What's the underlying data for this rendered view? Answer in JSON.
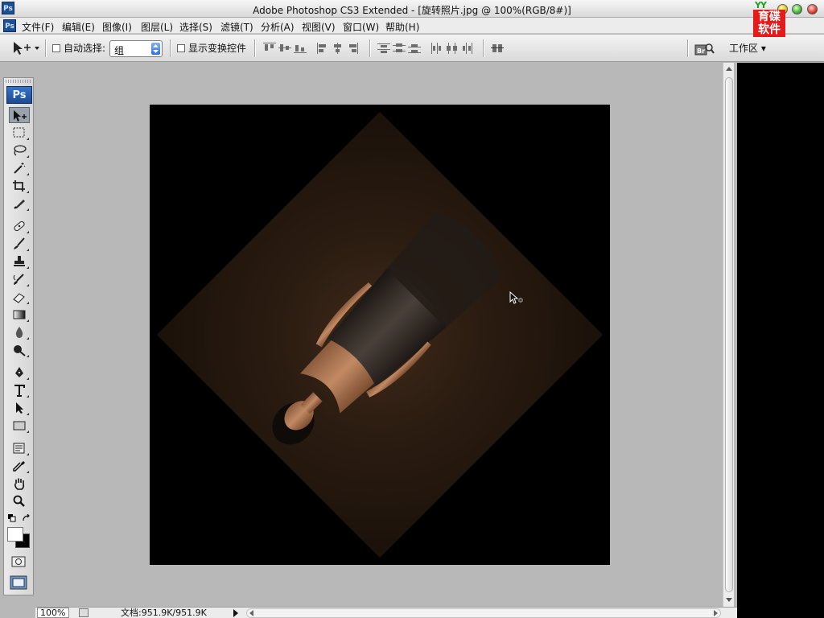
{
  "window": {
    "title": "Adobe Photoshop CS3 Extended - [旋转照片.jpg @ 100%(RGB/8#)]",
    "app_badge": "Ps"
  },
  "brand": {
    "top": "YY",
    "line1": "育碟",
    "line2": "软件"
  },
  "menu": {
    "items": [
      "文件(F)",
      "编辑(E)",
      "图像(I)",
      "图层(L)",
      "选择(S)",
      "滤镜(T)",
      "分析(A)",
      "视图(V)",
      "窗口(W)",
      "帮助(H)"
    ]
  },
  "options": {
    "auto_select_label": "自动选择:",
    "auto_select_value": "组",
    "show_transform_label": "显示变换控件",
    "workspace_label": "工作区 ▾"
  },
  "toolbox": {
    "badge": "Ps"
  },
  "status": {
    "zoom": "100%",
    "doc": "文档:951.9K/951.9K"
  },
  "colors": {
    "foreground": "#000000",
    "background": "#ffffff",
    "canvas_bg": "#000000",
    "workspace_bg": "#b8b8b8"
  }
}
